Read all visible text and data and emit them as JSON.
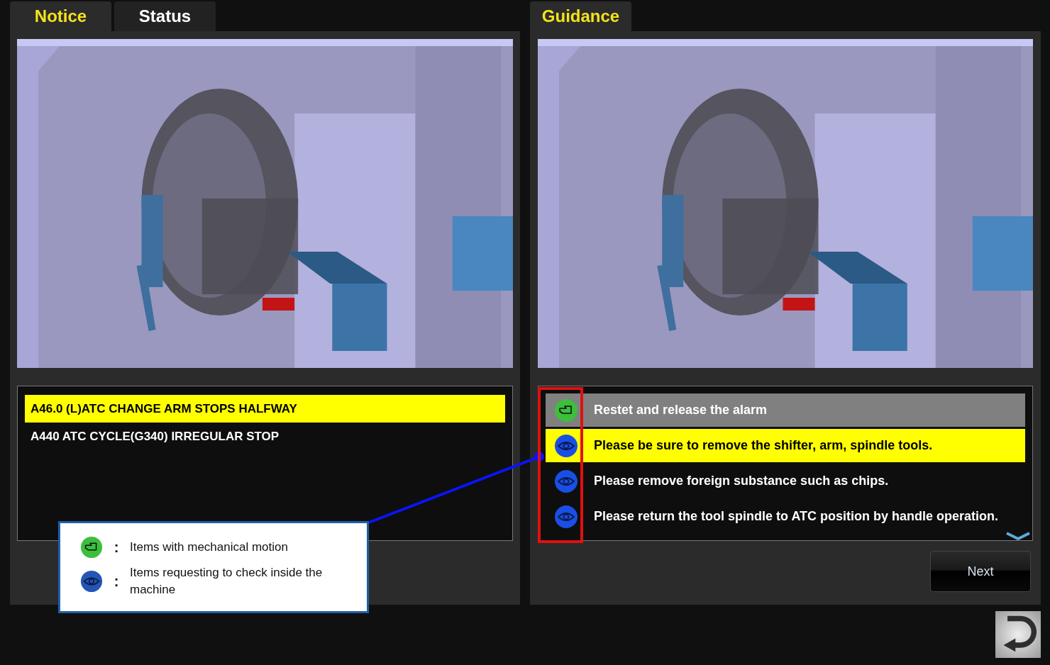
{
  "notice_panel": {
    "tabs": [
      {
        "label": "Notice",
        "selected": true
      },
      {
        "label": "Status",
        "selected": false
      }
    ],
    "alarms": [
      {
        "text": "A46.0 (L)ATC CHANGE ARM STOPS HALFWAY",
        "selected": true
      },
      {
        "text": "A440 ATC CYCLE(G340) IRREGULAR STOP",
        "selected": false
      }
    ]
  },
  "guidance_panel": {
    "tabs": [
      {
        "label": "Guidance",
        "selected": true
      }
    ],
    "items": [
      {
        "kind": "motion",
        "text": "Restet and release the alarm",
        "selected": false,
        "done": true
      },
      {
        "kind": "check",
        "text": "Please be sure to remove the shifter, arm, spindle tools.",
        "selected": true,
        "done": false
      },
      {
        "kind": "check",
        "text": "Please remove foreign substance such as chips.",
        "selected": false,
        "done": false
      },
      {
        "kind": "check",
        "text": "Please return the tool spindle to ATC position by handle operation.",
        "selected": false,
        "done": false
      }
    ],
    "next_button": "Next"
  },
  "legend": [
    {
      "kind": "motion",
      "separator": ":",
      "text": "Items with mechanical motion"
    },
    {
      "kind": "check",
      "separator": ":",
      "text": "Items requesting to check inside the machine"
    }
  ]
}
